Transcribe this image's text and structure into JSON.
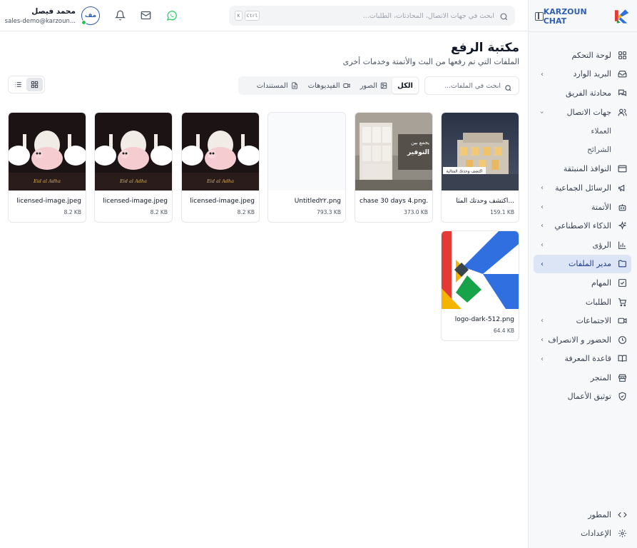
{
  "brand": {
    "name": "KARZOUN CHAT"
  },
  "header": {
    "search_placeholder": "ابحث في جهات الاتصال، المحادثات، الطلبات...",
    "kbd_ctrl": "Ctrl",
    "kbd_k": "K",
    "user_name": "محمد فيصل",
    "user_email": "sales-demo@karzoun...",
    "avatar_initials": "مف"
  },
  "sidebar": {
    "items": [
      {
        "label": "لوحة التحكم",
        "icon": "dashboard-icon"
      },
      {
        "label": "البريد الوارد",
        "icon": "inbox-icon"
      },
      {
        "label": "محادثة الفريق",
        "icon": "team-chat-icon"
      },
      {
        "label": "جهات الاتصال",
        "icon": "contacts-icon"
      },
      {
        "label": "العملاء"
      },
      {
        "label": "الشرائح"
      },
      {
        "label": "النوافذ المنبثقة",
        "icon": "popup-icon"
      },
      {
        "label": "الرسائل الجماعية",
        "icon": "megaphone-icon"
      },
      {
        "label": "الأتمتة",
        "icon": "bot-icon"
      },
      {
        "label": "الذكاء الاصطناعي",
        "icon": "sparkles-icon"
      },
      {
        "label": "الرؤى",
        "icon": "chart-icon"
      },
      {
        "label": "مدير الملفات",
        "icon": "folder-icon"
      },
      {
        "label": "المهام",
        "icon": "tasks-icon"
      },
      {
        "label": "الطلبات",
        "icon": "cart-icon"
      },
      {
        "label": "الاجتماعات",
        "icon": "video-icon"
      },
      {
        "label": "الحضور و الانصراف",
        "icon": "clock-icon"
      },
      {
        "label": "قاعدة المعرفة",
        "icon": "book-icon"
      },
      {
        "label": "المتجر",
        "icon": "store-icon"
      },
      {
        "label": "توثيق الأعمال",
        "icon": "shield-icon"
      }
    ],
    "bottom": [
      {
        "label": "المطور",
        "icon": "code-icon"
      },
      {
        "label": "الإعدادات",
        "icon": "gear-icon"
      }
    ]
  },
  "page": {
    "title": "مكتبة الرفع",
    "subtitle": "الملفات التي تم رفعها من البث والأتمتة وخدمات أخرى",
    "search_placeholder": "ابحث في الملفات..."
  },
  "tabs": [
    {
      "label": "الكل",
      "icon": ""
    },
    {
      "label": "الصور",
      "icon": "image-icon"
    },
    {
      "label": "الفيديوهات",
      "icon": "video-icon"
    },
    {
      "label": "المستندات",
      "icon": "document-icon"
    }
  ],
  "files": [
    {
      "name": "اكتشف وحدتك المثا...",
      "size": "159.1 KB"
    },
    {
      "name": "chase 30 days 4.png...",
      "size": "373.0 KB"
    },
    {
      "name": "Untitled٢٢.png",
      "size": "793.3 KB"
    },
    {
      "name": "licensed-image.jpeg",
      "size": "8.2 KB"
    },
    {
      "name": "licensed-image.jpeg",
      "size": "8.2 KB"
    },
    {
      "name": "licensed-image.jpeg",
      "size": "8.2 KB"
    },
    {
      "name": "logo-dark-512.png",
      "size": "64.4 KB"
    }
  ],
  "thumb_text": {
    "villa_caption": "اكتشف وحدتك المثالية",
    "ramadan_banner_line1": "يجمع بين",
    "ramadan_banner_line2": "التوفير",
    "eid_caption": "Eid al Adha"
  },
  "colors": {
    "brand_blue": "#2f5fb3",
    "active_nav_bg": "#dbe5f5",
    "whatsapp_green": "#25d366",
    "online_green": "#22c55e"
  }
}
